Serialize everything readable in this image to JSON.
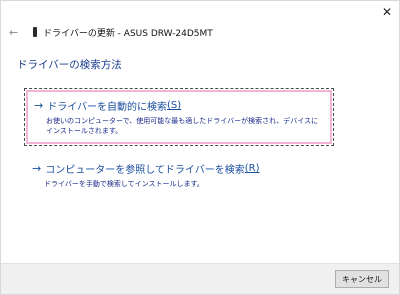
{
  "window": {
    "close_glyph": "✕",
    "back_glyph": "←",
    "title": "ドライバーの更新 - ASUS DRW-24D5MT"
  },
  "heading": "ドライバーの検索方法",
  "options": [
    {
      "title": "ドライバーを自動的に検索",
      "accesskey": "(S)",
      "description": "お使いのコンピューターで、使用可能な最も適したドライバーが検索され、デバイスにインストールされます。"
    },
    {
      "title": "コンピューターを参照してドライバーを検索",
      "accesskey": "(R)",
      "description": "ドライバーを手動で検索してインストールします。"
    }
  ],
  "footer": {
    "cancel_label": "キャンセル"
  },
  "colors": {
    "link": "#1a4fa0",
    "focus_highlight": "#f2b4d4",
    "footer_bg": "#f0f0f0"
  },
  "icons": {
    "close": "close-icon",
    "back": "back-arrow-icon",
    "drive": "drive-icon",
    "option_arrow": "arrow-right-icon"
  }
}
